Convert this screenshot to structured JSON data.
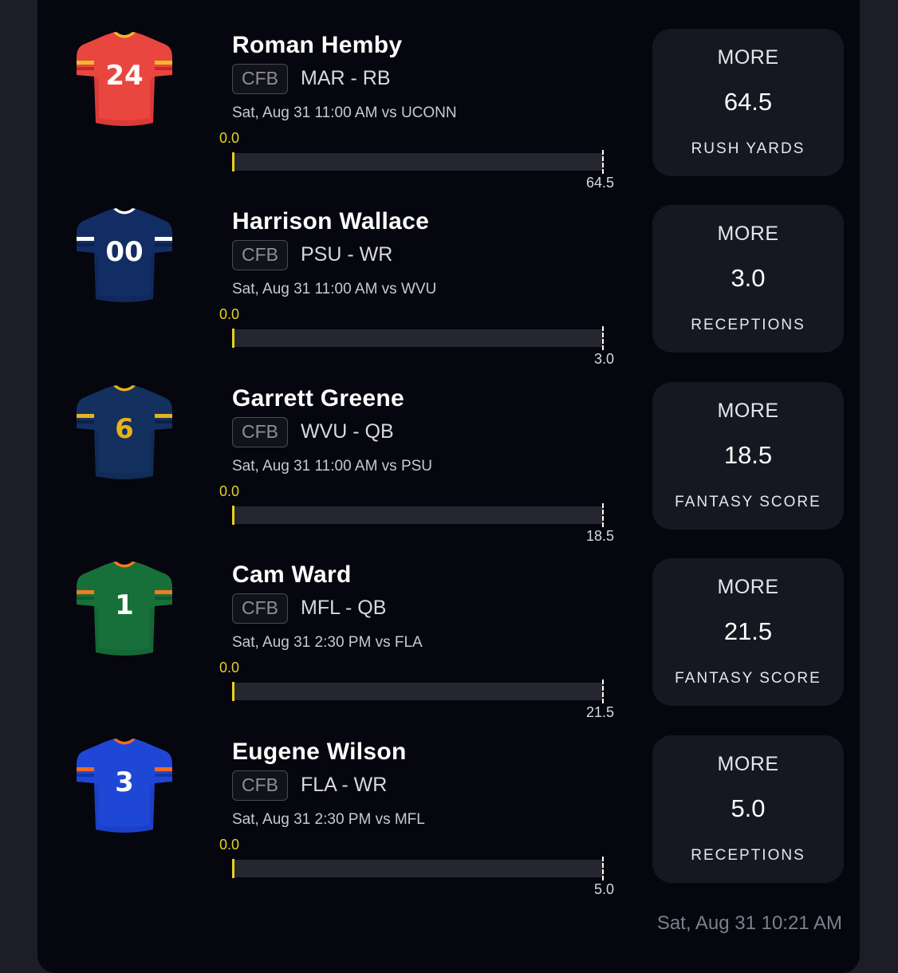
{
  "picks": [
    {
      "player": "Roman Hemby",
      "league": "CFB",
      "team_position": "MAR - RB",
      "game": "Sat, Aug 31 11:00 AM  vs UCONN",
      "jersey": {
        "number": "24",
        "body_color": "#e8463f",
        "trim_color": "#f2b92c",
        "stripe_color": "#c7262a",
        "number_color": "#ffffff"
      },
      "progress": {
        "current": "0.0",
        "line": "64.5",
        "fraction": 0.0
      },
      "prop": {
        "direction": "MORE",
        "value": "64.5",
        "stat": "RUSH YARDS"
      }
    },
    {
      "player": "Harrison Wallace",
      "league": "CFB",
      "team_position": "PSU - WR",
      "game": "Sat, Aug 31 11:00 AM  vs WVU",
      "jersey": {
        "number": "00",
        "body_color": "#112d64",
        "trim_color": "#ffffff",
        "stripe_color": "#0b214c",
        "number_color": "#ffffff"
      },
      "progress": {
        "current": "0.0",
        "line": "3.0",
        "fraction": 0.0
      },
      "prop": {
        "direction": "MORE",
        "value": "3.0",
        "stat": "RECEPTIONS"
      }
    },
    {
      "player": "Garrett Greene",
      "league": "CFB",
      "team_position": "WVU - QB",
      "game": "Sat, Aug 31 11:00 AM  vs PSU",
      "jersey": {
        "number": "6",
        "body_color": "#13305f",
        "trim_color": "#e7b21a",
        "stripe_color": "#0c2147",
        "number_color": "#e7b21a"
      },
      "progress": {
        "current": "0.0",
        "line": "18.5",
        "fraction": 0.0
      },
      "prop": {
        "direction": "MORE",
        "value": "18.5",
        "stat": "FANTASY SCORE"
      }
    },
    {
      "player": "Cam Ward",
      "league": "CFB",
      "team_position": "MFL - QB",
      "game": "Sat, Aug 31 2:30 PM  vs FLA",
      "jersey": {
        "number": "1",
        "body_color": "#17703a",
        "trim_color": "#f47a20",
        "stripe_color": "#0f5a2d",
        "number_color": "#ffffff"
      },
      "progress": {
        "current": "0.0",
        "line": "21.5",
        "fraction": 0.0
      },
      "prop": {
        "direction": "MORE",
        "value": "21.5",
        "stat": "FANTASY SCORE"
      }
    },
    {
      "player": "Eugene Wilson",
      "league": "CFB",
      "team_position": "FLA - WR",
      "game": "Sat, Aug 31 2:30 PM  vs MFL",
      "jersey": {
        "number": "3",
        "body_color": "#1f47d6",
        "trim_color": "#f26a21",
        "stripe_color": "#1535a8",
        "number_color": "#ffffff"
      },
      "progress": {
        "current": "0.0",
        "line": "5.0",
        "fraction": 0.0
      },
      "prop": {
        "direction": "MORE",
        "value": "5.0",
        "stat": "RECEPTIONS"
      }
    }
  ],
  "footer": {
    "timestamp": "Sat, Aug 31 10:21 AM"
  }
}
